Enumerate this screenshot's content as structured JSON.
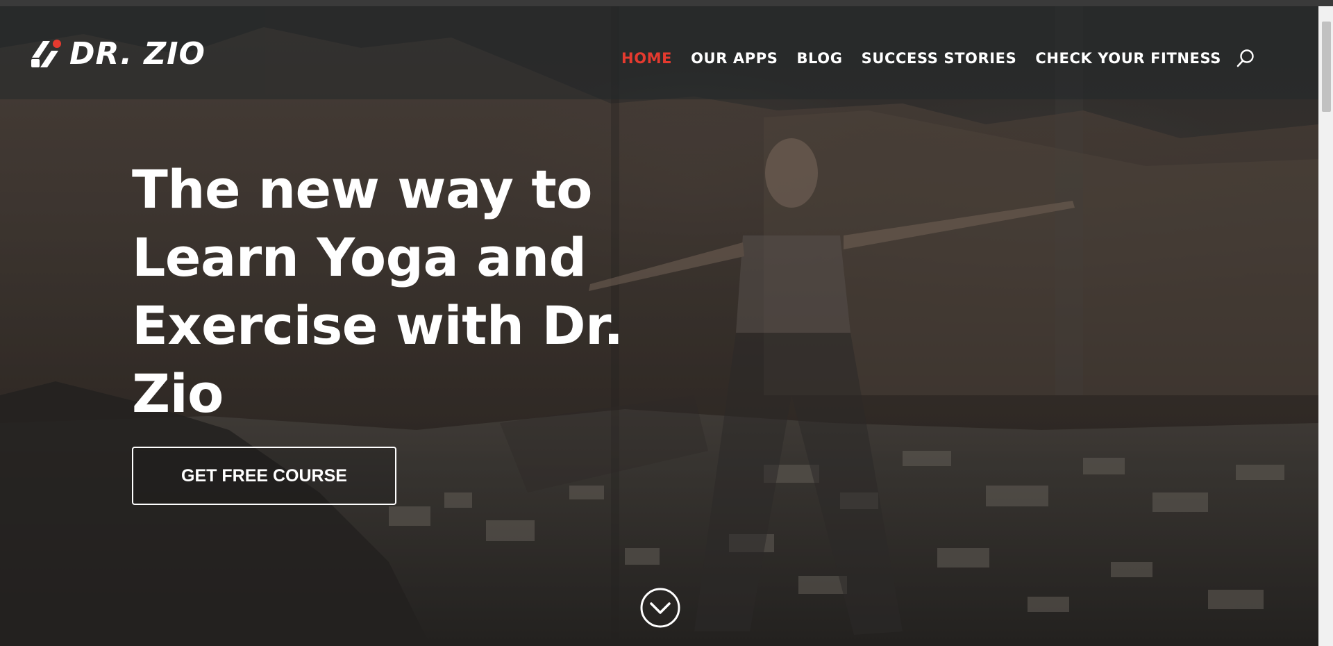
{
  "brand": {
    "name": "DR. ZIO",
    "accent_color": "#e53a2f"
  },
  "nav": {
    "items": [
      {
        "label": "HOME",
        "active": true
      },
      {
        "label": "OUR APPS",
        "active": false
      },
      {
        "label": "BLOG",
        "active": false
      },
      {
        "label": "SUCCESS STORIES",
        "active": false
      },
      {
        "label": "CHECK YOUR FITNESS",
        "active": false
      }
    ],
    "search_icon": "search-icon"
  },
  "hero": {
    "headline": "The new way to Learn Yoga and Exercise with Dr. Zio",
    "cta_label": "GET FREE COURSE",
    "scroll_icon": "chevron-down-circle-icon"
  }
}
